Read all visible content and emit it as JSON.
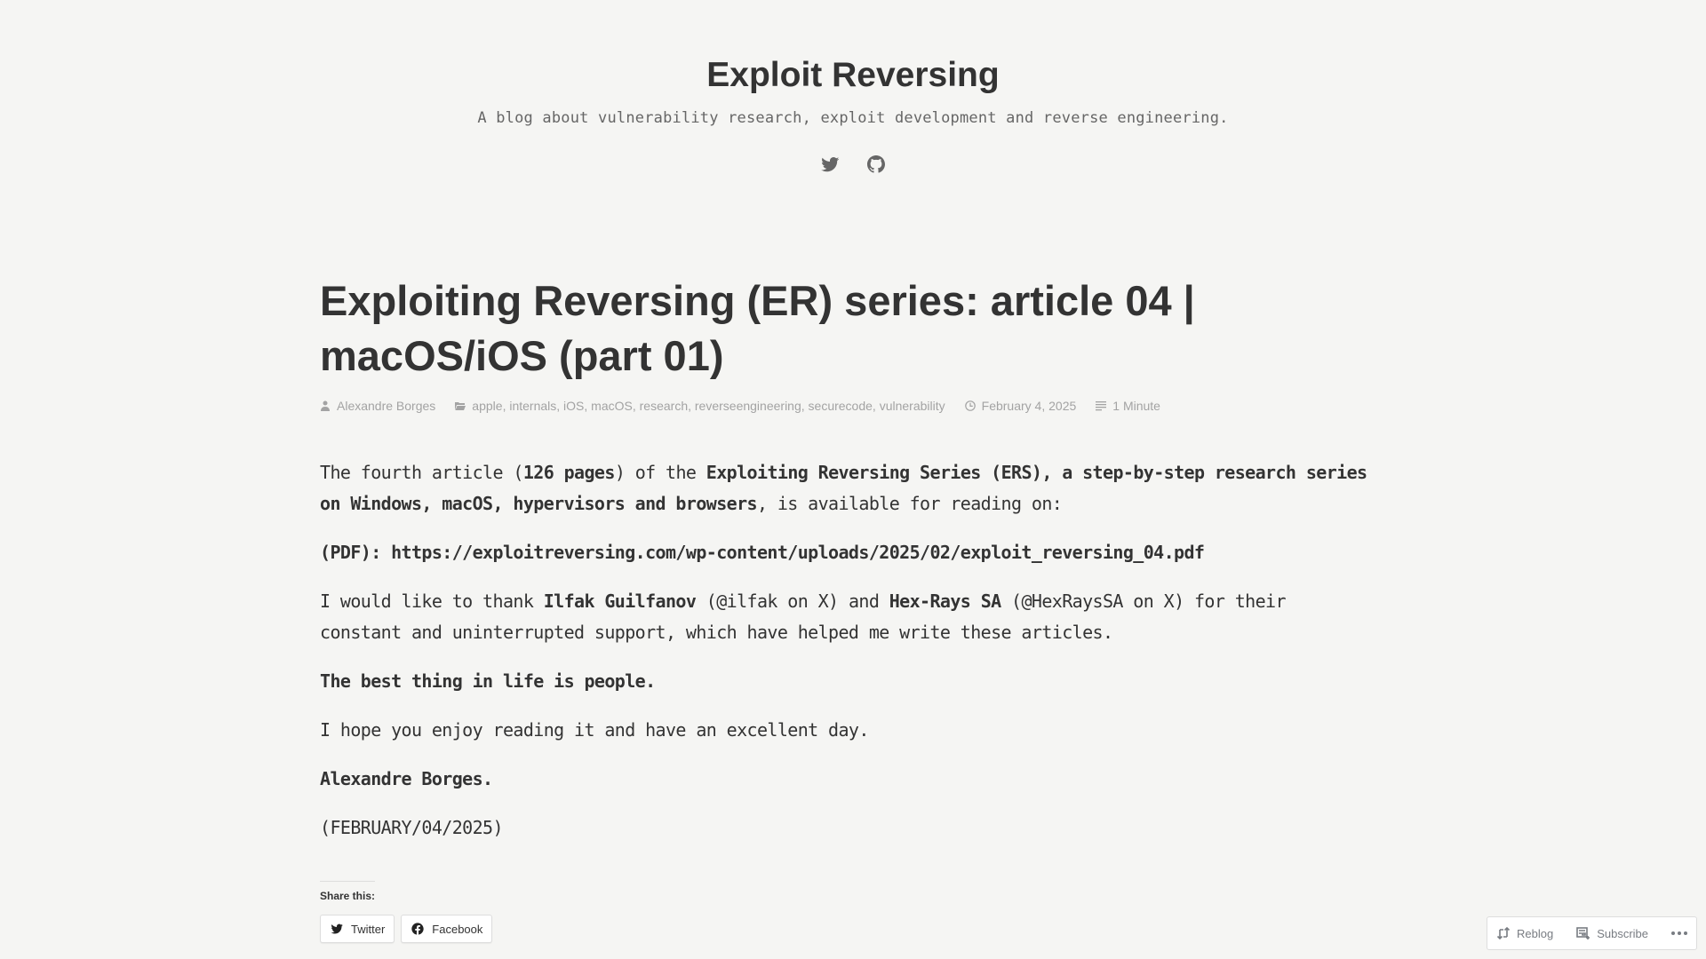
{
  "site": {
    "title": "Exploit Reversing",
    "description": "A blog about vulnerability research, exploit development and reverse engineering.",
    "social_icons": [
      "twitter-icon",
      "github-icon"
    ]
  },
  "post": {
    "title": "Exploiting Reversing (ER) series: article 04 | macOS/iOS (part 01)",
    "meta": {
      "author": "Alexandre Borges",
      "categories": [
        "apple",
        "internals",
        "iOS",
        "macOS",
        "research",
        "reverseengineering",
        "securecode",
        "vulnerability"
      ],
      "date": "February 4, 2025",
      "reading_time": "1 Minute"
    },
    "content": {
      "p1": {
        "t1": "The fourth article (",
        "b1": "126 pages",
        "t2": ") of the ",
        "b2": "Exploiting Reversing Series (ERS), a step-by-step research series on Windows, macOS, hypervisors and browsers",
        "t3": ", is available for reading on:"
      },
      "p2": "(PDF): https://exploitreversing.com/wp-content/uploads/2025/02/exploit_reversing_04.pdf",
      "p3": {
        "t1": "I would like to thank ",
        "b1": "Ilfak Guilfanov",
        "t2": " (@ilfak on X) and ",
        "b2": "Hex-Rays SA",
        "t3": " (@HexRaysSA on X) for their constant and uninterrupted support, which have helped me write these articles."
      },
      "p4": "The best thing in life is people.",
      "p5": "I hope you enjoy reading it and have an excellent day.",
      "p6": "Alexandre Borges.",
      "p7": "(FEBRUARY/04/2025)"
    }
  },
  "share": {
    "title": "Share this:",
    "buttons": [
      {
        "label": "Twitter",
        "icon": "twitter-icon"
      },
      {
        "label": "Facebook",
        "icon": "facebook-icon"
      }
    ]
  },
  "action_bar": {
    "reblog": "Reblog",
    "subscribe": "Subscribe",
    "more": "more-icon"
  }
}
